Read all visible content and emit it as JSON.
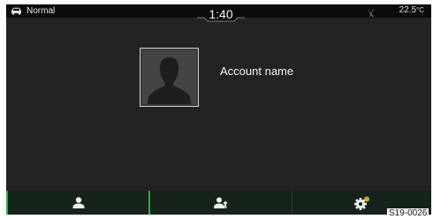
{
  "status": {
    "drive_mode": "Normal",
    "time": "1:40",
    "temperature": "22.5",
    "temperature_unit": "°C"
  },
  "profile": {
    "account_name": "Account name"
  },
  "bottom_tabs": [
    {
      "icon": "person-icon"
    },
    {
      "icon": "users-switch-icon"
    },
    {
      "icon": "settings-gear-icon"
    }
  ],
  "figure_label": "S19-0026",
  "colors": {
    "screen_bg": "#232323",
    "status_bg": "#0b0b0b",
    "tab_bar_bg": "#16231a",
    "accent_green": "#3aa84a",
    "gear_dot": "#e0a020"
  }
}
